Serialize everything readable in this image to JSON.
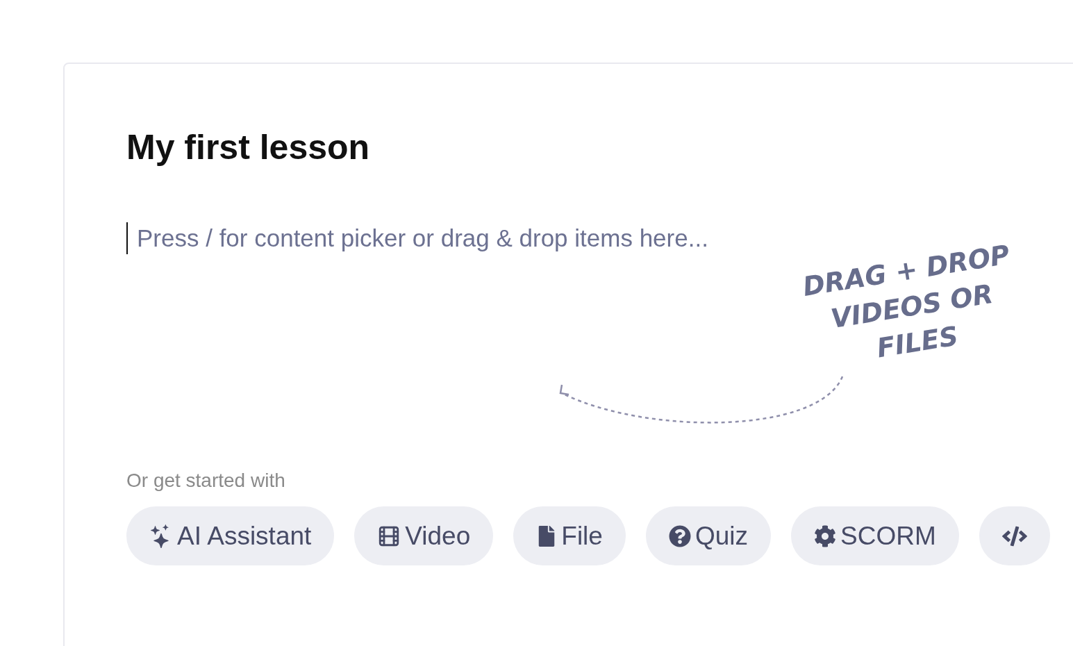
{
  "lesson": {
    "title": "My first lesson",
    "editor_placeholder": "Press / for content picker or drag & drop items here..."
  },
  "annotation": {
    "lines": [
      "DRAG + DROP",
      "VIDEOS OR",
      "FILES"
    ]
  },
  "get_started": {
    "label": "Or get started with",
    "chips": [
      {
        "kind": "ai",
        "label": "AI Assistant"
      },
      {
        "kind": "video",
        "label": "Video"
      },
      {
        "kind": "file",
        "label": "File"
      },
      {
        "kind": "quiz",
        "label": "Quiz"
      },
      {
        "kind": "scorm",
        "label": "SCORM"
      },
      {
        "kind": "code"
      }
    ]
  }
}
